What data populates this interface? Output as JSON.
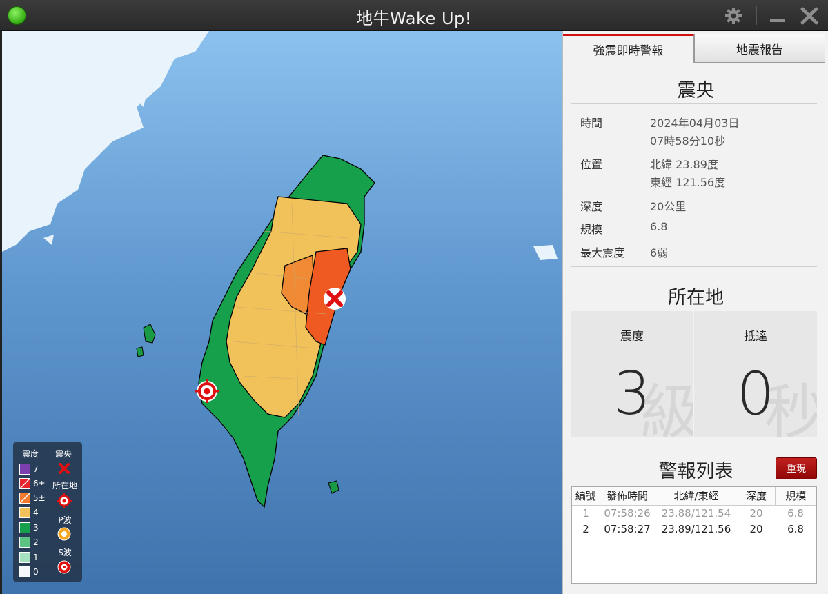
{
  "app": {
    "title": "地牛Wake Up!"
  },
  "tabs": [
    {
      "label": "強震即時警報",
      "active": true
    },
    {
      "label": "地震報告",
      "active": false
    }
  ],
  "epicenter": {
    "title": "震央",
    "time_label": "時間",
    "date": "2024年04月03日",
    "time": "07時58分10秒",
    "position_label": "位置",
    "lat": "北緯 23.89度",
    "lon": "東經 121.56度",
    "depth_label": "深度",
    "depth": "20公里",
    "magnitude_label": "規模",
    "magnitude": "6.8",
    "max_intensity_label": "最大震度",
    "max_intensity": "6弱"
  },
  "location": {
    "title": "所在地",
    "intensity_label": "震度",
    "intensity_value": "3",
    "intensity_watermark": "級",
    "arrival_label": "抵達",
    "arrival_value": "0",
    "arrival_watermark": "秒"
  },
  "alerts": {
    "title": "警報列表",
    "reset_label": "重現",
    "headers": [
      "編號",
      "發佈時間",
      "北緯/東經",
      "深度",
      "規模"
    ],
    "rows": [
      [
        "1",
        "07:58:26",
        "23.88/121.54",
        "20",
        "6.8"
      ],
      [
        "2",
        "07:58:27",
        "23.89/121.56",
        "20",
        "6.8"
      ]
    ]
  },
  "legend": {
    "intensity_title": "震度",
    "epicenter_title": "震央",
    "location_title": "所在地",
    "p_wave_title": "P波",
    "s_wave_title": "S波",
    "levels": [
      {
        "label": "7",
        "color": "#7b3fb0"
      },
      {
        "label": "6±",
        "color": "#e8232b"
      },
      {
        "label": "5±",
        "color": "#f47a2e"
      },
      {
        "label": "4",
        "color": "#f2c25a"
      },
      {
        "label": "3",
        "color": "#16a04b"
      },
      {
        "label": "2",
        "color": "#5cc383"
      },
      {
        "label": "1",
        "color": "#a5e0c0"
      },
      {
        "label": "0",
        "color": "#f5f8fb"
      }
    ]
  },
  "colors": {
    "accent": "#d01010",
    "sea": "#5f97cf"
  }
}
